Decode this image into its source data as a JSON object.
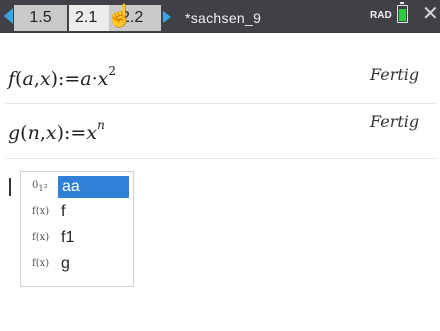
{
  "header": {
    "tabs": [
      "1.5",
      "2.1",
      "2.2"
    ],
    "document_title": "*sachsen_9",
    "angle_mode": "RAD"
  },
  "calculator": {
    "entries": [
      {
        "input_label": "f(a,x):=a·x^2",
        "status": "Fertig"
      },
      {
        "input_label": "g(n,x):=x^n",
        "status": "Fertig"
      }
    ]
  },
  "autocomplete": {
    "items": [
      {
        "icon": "variable-icon",
        "label": "aa",
        "selected": true
      },
      {
        "icon": "function-icon",
        "label": "f",
        "selected": false
      },
      {
        "icon": "function-icon",
        "label": "f1",
        "selected": false
      },
      {
        "icon": "function-icon",
        "label": "g",
        "selected": false
      }
    ]
  },
  "colors": {
    "topbar": "#3f4146",
    "accent": "#36a4e6",
    "selection": "#2f80d6",
    "battery": "#2ecc40"
  }
}
